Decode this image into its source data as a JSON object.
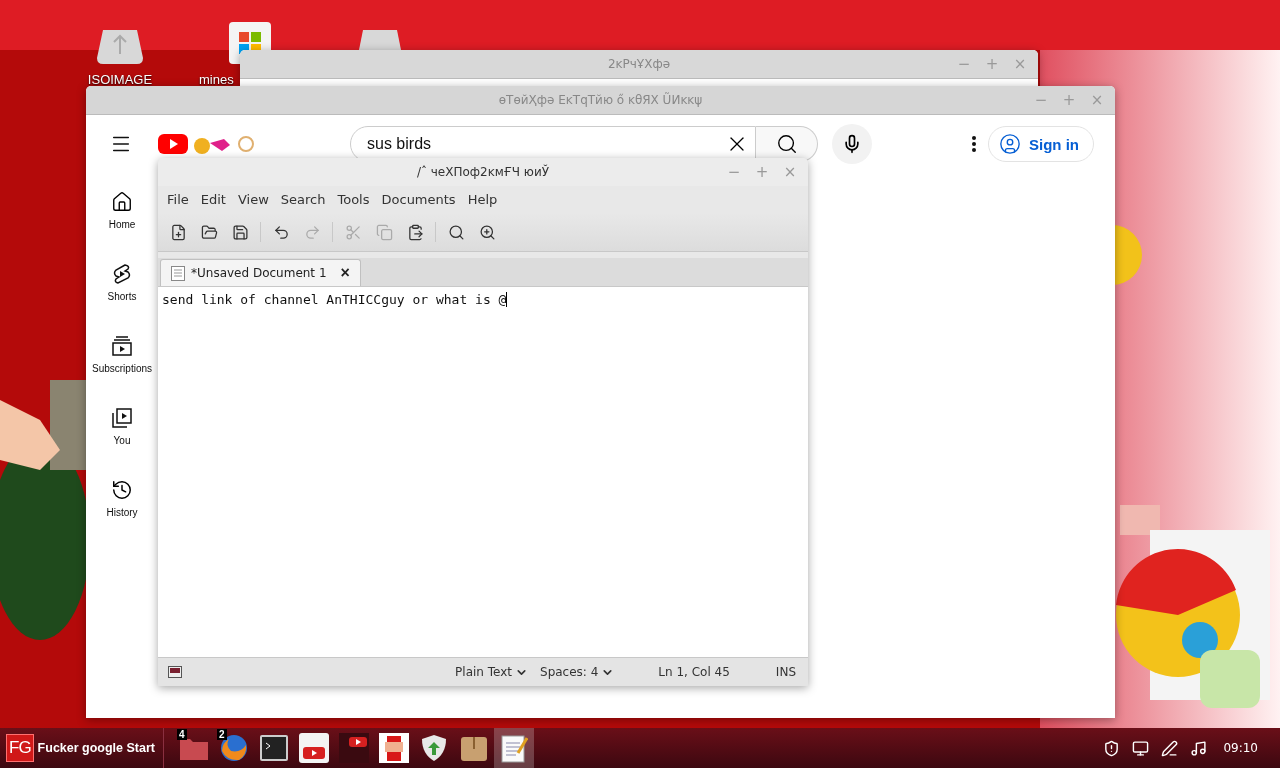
{
  "desktop": {
    "icons": [
      {
        "kind": "drive",
        "label": "ISOIMAGE"
      },
      {
        "kind": "app",
        "label": "mines"
      },
      {
        "kind": "drive"
      }
    ]
  },
  "back_window": {
    "title": "2ĸРчҰХфә",
    "controls": [
      "−",
      "+",
      "×"
    ]
  },
  "browser_window": {
    "title": "өТөйҲфә ЕĸТqТйю  ő ĸθЯХ ŨИĸĸψ",
    "controls": [
      "−",
      "+",
      "×"
    ],
    "search": {
      "value": "sus birds"
    },
    "sign_in": "Sign in",
    "sidebar": [
      {
        "kind": "home",
        "label": "Home"
      },
      {
        "kind": "shorts",
        "label": "Shorts"
      },
      {
        "kind": "subscriptions",
        "label": "Subscriptions"
      },
      {
        "kind": "you",
        "label": "You"
      },
      {
        "kind": "history",
        "label": "History"
      }
    ]
  },
  "editor_window": {
    "title": "/ˆ чеХПоф2ĸмҒЧ юиЎ",
    "controls": [
      "−",
      "+",
      "×"
    ],
    "menu": [
      "File",
      "Edit",
      "View",
      "Search",
      "Tools",
      "Documents",
      "Help"
    ],
    "toolbar": [
      [
        {
          "kind": "new",
          "disabled": false
        },
        {
          "kind": "open",
          "disabled": false
        },
        {
          "kind": "save",
          "disabled": false
        }
      ],
      [
        {
          "kind": "undo",
          "disabled": false
        },
        {
          "kind": "redo",
          "disabled": true
        }
      ],
      [
        {
          "kind": "cut",
          "disabled": true
        },
        {
          "kind": "copy",
          "disabled": true
        },
        {
          "kind": "paste",
          "disabled": false
        }
      ],
      [
        {
          "kind": "find",
          "disabled": false
        },
        {
          "kind": "replace",
          "disabled": false
        }
      ]
    ],
    "tab": {
      "label": "*Unsaved Document 1",
      "close": "×"
    },
    "text": "send link of channel AnTHICCguy or what is @",
    "status": {
      "language": "Plain Text",
      "spaces": "Spaces: 4",
      "position": "Ln 1, Col 45",
      "mode": "INS"
    }
  },
  "taskbar": {
    "logo": "FG",
    "start_label": "Fucker google Start",
    "launchers": [
      {
        "kind": "folder",
        "badge": "4",
        "selected": false
      },
      {
        "kind": "browser",
        "badge": "2",
        "selected": false
      },
      {
        "kind": "terminal",
        "selected": false
      },
      {
        "kind": "video",
        "selected": false
      },
      {
        "kind": "video-dark",
        "selected": false
      },
      {
        "kind": "game",
        "selected": false
      },
      {
        "kind": "shield",
        "selected": false
      },
      {
        "kind": "package",
        "selected": false
      },
      {
        "kind": "notepad",
        "selected": true
      }
    ],
    "tray": [
      {
        "kind": "shield"
      },
      {
        "kind": "display"
      },
      {
        "kind": "pen"
      },
      {
        "kind": "music"
      }
    ],
    "clock": "09:10"
  }
}
